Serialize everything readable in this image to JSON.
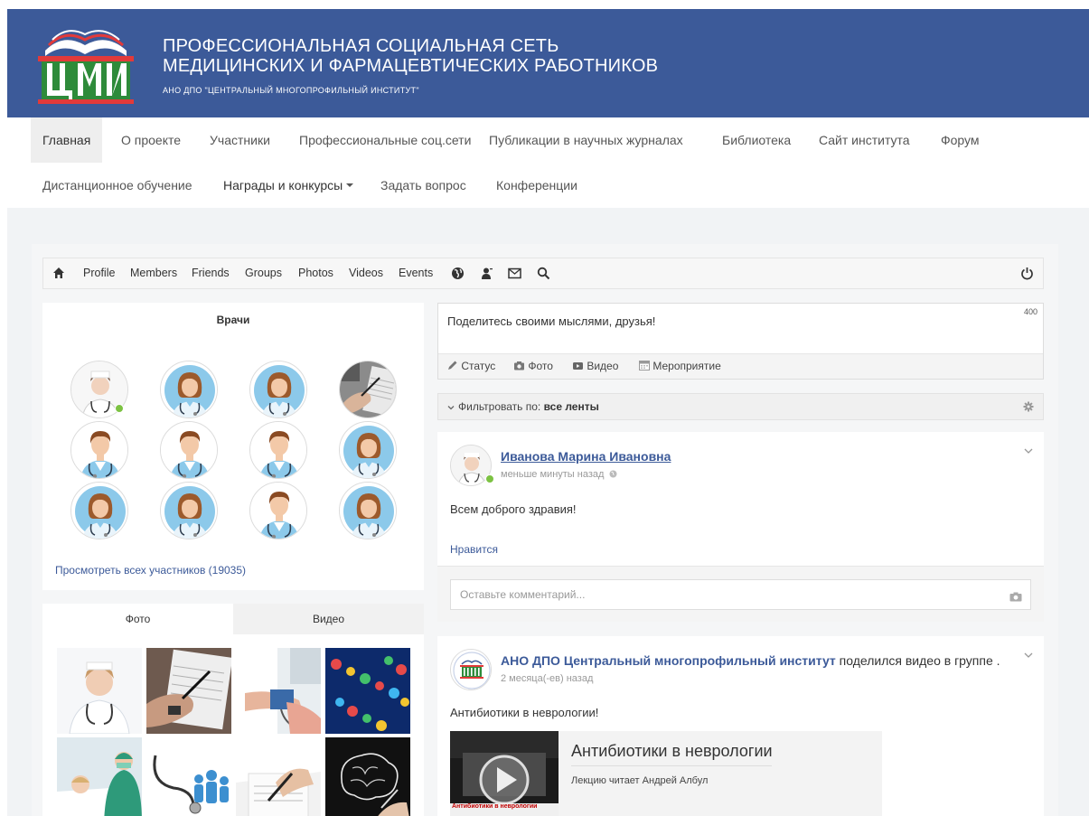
{
  "header": {
    "title_line1": "ПРОФЕССИОНАЛЬНАЯ СОЦИАЛЬНАЯ СЕТЬ",
    "title_line2": "МЕДИЦИНСКИХ И ФАРМАЦЕВТИЧЕСКИХ РАБОТНИКОВ",
    "subtitle": "АНО ДПО \"ЦЕНТРАЛЬНЫЙ МНОГОПРОФИЛЬНЫЙ ИНСТИТУТ\"",
    "logo_text": "ЦМИ",
    "background_color": "#3c5a99"
  },
  "site_nav": {
    "items": [
      {
        "label": "Главная",
        "active": true
      },
      {
        "label": "О проекте"
      },
      {
        "label": "Участники"
      },
      {
        "label": "Профессиональные соц.сети"
      },
      {
        "label": "Публикации в научных журналах"
      },
      {
        "label": "Библиотека"
      },
      {
        "label": "Сайт института"
      },
      {
        "label": "Форум"
      },
      {
        "label": "Дистанционное обучение"
      },
      {
        "label": "Награды и конкурсы",
        "dropdown": true
      },
      {
        "label": "Задать вопрос"
      },
      {
        "label": "Конференции"
      }
    ]
  },
  "toolbar": {
    "items": [
      {
        "icon": "home-icon"
      },
      {
        "label": "Profile"
      },
      {
        "label": "Members"
      },
      {
        "label": "Friends"
      },
      {
        "label": "Groups"
      },
      {
        "label": "Photos"
      },
      {
        "label": "Videos"
      },
      {
        "label": "Events"
      },
      {
        "icon": "globe-icon"
      },
      {
        "icon": "friend-requests-icon"
      },
      {
        "icon": "messages-icon"
      },
      {
        "icon": "search-icon"
      },
      {
        "icon": "power-icon"
      }
    ]
  },
  "members": {
    "title": "Врачи",
    "view_all": "Просмотреть всех участников (19035)",
    "avatars": [
      "female-doctor-photo",
      "female-doctor",
      "female-doctor",
      "photo-hand-writing",
      "male-doctor",
      "male-doctor",
      "male-doctor",
      "female-doctor",
      "female-doctor",
      "female-doctor",
      "male-doctor",
      "female-doctor"
    ],
    "online_status_color": "#7cc242"
  },
  "media_tabs": {
    "photo": "Фото",
    "video": "Видео",
    "photos": [
      "nurse-with-stethoscope",
      "hand-writing",
      "doctor-measuring-pressure",
      "dna-molecules",
      "surgeons-with-patient",
      "stethoscope-and-people",
      "doctor-writing-notes",
      "brain-drawing"
    ]
  },
  "composer": {
    "placeholder": "Поделитесь своими мыслями, друзья!",
    "char_count": "400",
    "actions": [
      {
        "label": "Статус",
        "icon": "pencil-icon"
      },
      {
        "label": "Фото",
        "icon": "camera-icon"
      },
      {
        "label": "Видео",
        "icon": "video-icon"
      },
      {
        "label": "Мероприятие",
        "icon": "calendar-icon"
      }
    ]
  },
  "filter": {
    "prefix": "Фильтровать по:",
    "value": "все ленты"
  },
  "posts": [
    {
      "author": "Иванова Марина Ивановна",
      "time": "меньше минуты назад",
      "text": "Всем доброго здравия!",
      "like": "Нравится",
      "comment_placeholder": "Оставьте комментарий..."
    },
    {
      "author": "АНО ДПО Центральный многопрофильный институт",
      "action": "поделился видео в группе .",
      "time": "2 месяца(-ев) назад",
      "text": "Антибиотики в неврологии!",
      "video": {
        "title": "Антибиотики в неврологии",
        "description": "Лекцию читает Андрей Албул",
        "thumb_caption": "Антибиотики в неврологии"
      }
    }
  ],
  "colors": {
    "accent": "#3c5a99",
    "page_bg": "#f1f3f5"
  }
}
